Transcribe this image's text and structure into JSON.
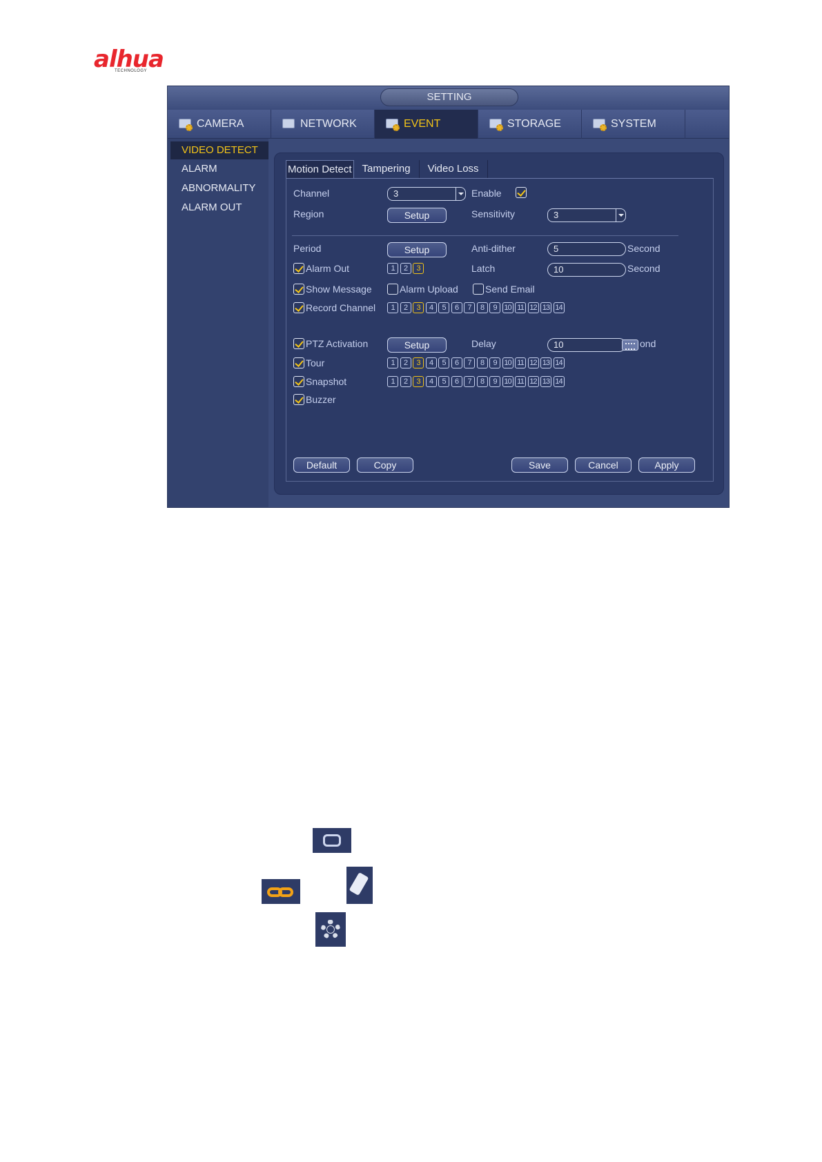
{
  "logo": {
    "brand": "alhua",
    "sub": "TECHNOLOGY"
  },
  "window": {
    "title": "SETTING"
  },
  "main_tabs": [
    {
      "label": "CAMERA",
      "icon": "camera-settings-icon"
    },
    {
      "label": "NETWORK",
      "icon": "network-icon"
    },
    {
      "label": "EVENT",
      "icon": "event-icon",
      "active": true
    },
    {
      "label": "STORAGE",
      "icon": "storage-icon"
    },
    {
      "label": "SYSTEM",
      "icon": "system-icon"
    }
  ],
  "side_menu": [
    {
      "label": "VIDEO DETECT",
      "active": true
    },
    {
      "label": "ALARM"
    },
    {
      "label": "ABNORMALITY"
    },
    {
      "label": "ALARM OUT"
    }
  ],
  "sub_tabs": [
    {
      "label": "Motion Detect",
      "active": true
    },
    {
      "label": "Tampering"
    },
    {
      "label": "Video Loss"
    }
  ],
  "form": {
    "channel_label": "Channel",
    "channel_value": "3",
    "enable_label": "Enable",
    "enable_checked": true,
    "region_label": "Region",
    "region_button": "Setup",
    "sensitivity_label": "Sensitivity",
    "sensitivity_value": "3",
    "period_label": "Period",
    "period_button": "Setup",
    "anti_dither_label": "Anti-dither",
    "anti_dither_value": "5",
    "second_label": "Second",
    "alarm_out_label": "Alarm Out",
    "alarm_out_checked": true,
    "alarm_out_channels": [
      "1",
      "2",
      "3"
    ],
    "alarm_out_selected": [
      "3"
    ],
    "latch_label": "Latch",
    "latch_value": "10",
    "latch_unit": "Second",
    "show_message_label": "Show Message",
    "alarm_upload_label": "Alarm Upload",
    "send_email_label": "Send Email",
    "record_channel_label": "Record Channel",
    "ptz_label": "PTZ Activation",
    "ptz_button": "Setup",
    "delay_label": "Delay",
    "delay_value": "10",
    "delay_unit": "ond",
    "tour_label": "Tour",
    "snapshot_label": "Snapshot",
    "buzzer_label": "Buzzer",
    "channels_14": [
      "1",
      "2",
      "3",
      "4",
      "5",
      "6",
      "7",
      "8",
      "9",
      "10",
      "11",
      "12",
      "13",
      "14"
    ],
    "selected_channel": "3"
  },
  "buttons": {
    "default": "Default",
    "copy": "Copy",
    "save": "Save",
    "cancel": "Cancel",
    "apply": "Apply"
  },
  "colors": {
    "accent": "#f3c418",
    "window_bg": "#3a4a78",
    "panel_bg": "#2c3a66",
    "link_icon": "#f3a216"
  },
  "icons": [
    "region-rect-icon",
    "link-icon",
    "eraser-icon",
    "gear-icon"
  ]
}
